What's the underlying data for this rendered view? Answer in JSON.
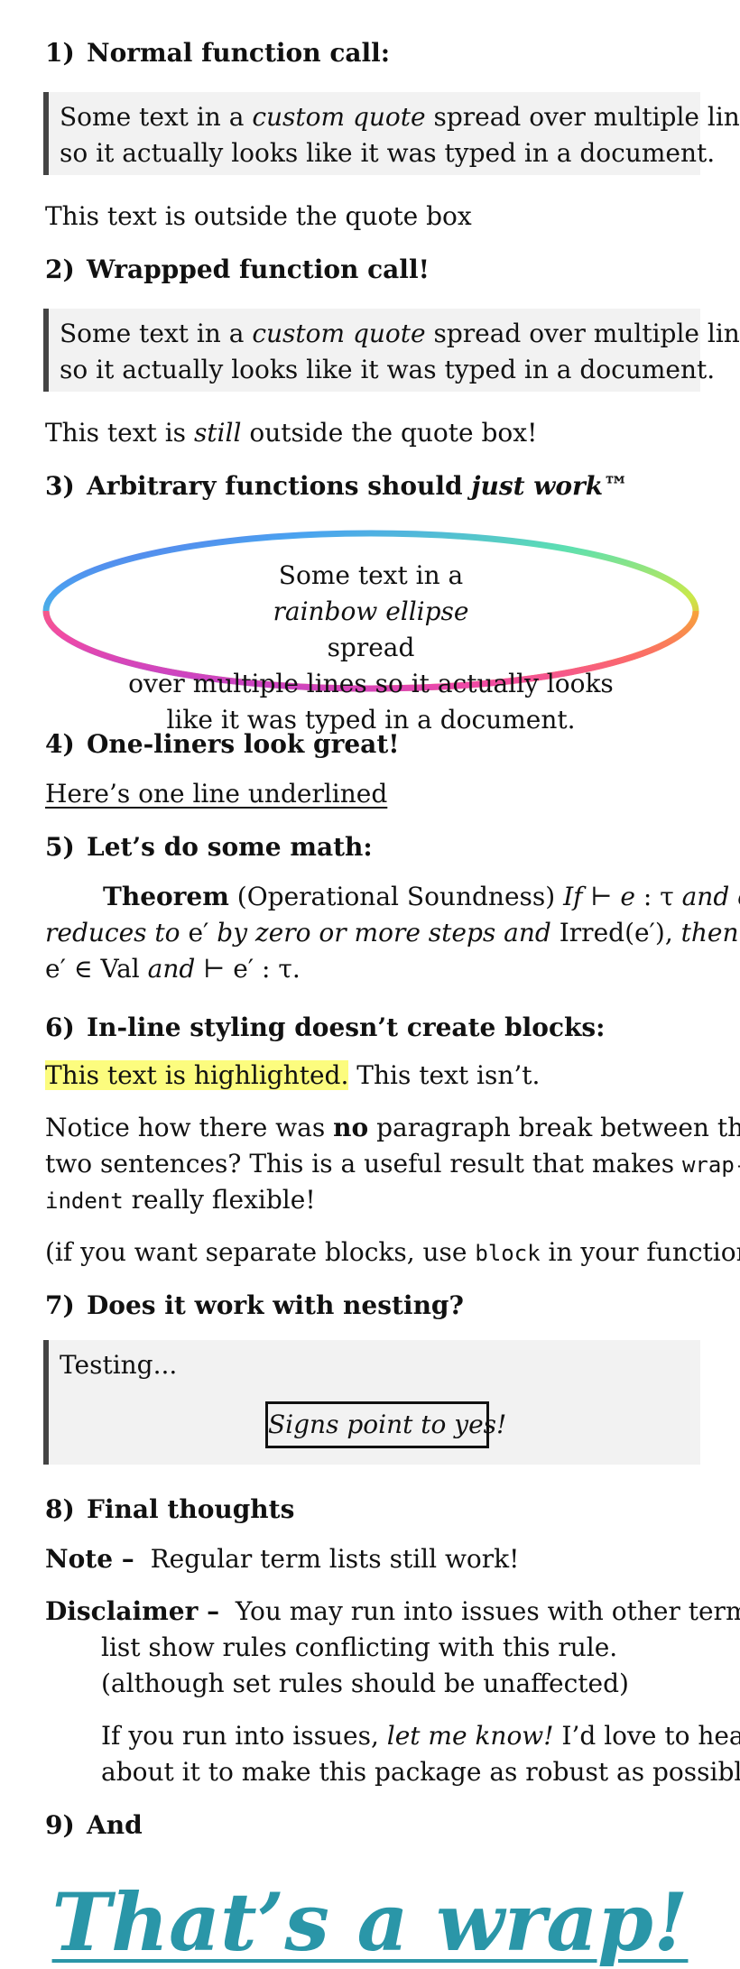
{
  "sections": {
    "s1": {
      "num": "1)",
      "title": "Normal function call:"
    },
    "s2": {
      "num": "2)",
      "title": "Wrappped function call!"
    },
    "s3": {
      "num": "3)",
      "title_a": "Arbitrary functions should ",
      "title_b": "just work™"
    },
    "s4": {
      "num": "4)",
      "title": "One-liners look great!"
    },
    "s5": {
      "num": "5)",
      "title": "Let’s do some math:"
    },
    "s6": {
      "num": "6)",
      "title": "In-line styling doesn’t create blocks:"
    },
    "s7": {
      "num": "7)",
      "title": "Does it work with nesting?"
    },
    "s8": {
      "num": "8)",
      "title": "Final thoughts"
    },
    "s9": {
      "num": "9)",
      "title": "And"
    }
  },
  "quote1": {
    "a": "Some text in a ",
    "b": "custom quote",
    "c": " spread over multiple lines",
    "d": "so it actually looks like it was typed in a document."
  },
  "outside1": "This text is outside the quote box",
  "quote2": {
    "a": "Some text in a ",
    "b": "custom quote",
    "c": " spread over multiple lines",
    "d": "so it actually looks like it was typed in a document."
  },
  "outside2": {
    "a": "This text is ",
    "b": "still",
    "c": " outside the quote box!"
  },
  "ellipse": {
    "l1a": "Some text in a ",
    "l1b": "rainbow ellipse",
    "l1c": " spread",
    "l2": "over multiple lines so it actually looks",
    "l3": "like it was typed in a document."
  },
  "underlined": "Here’s one line underlined",
  "theorem": {
    "name": "Theorem",
    "paren": " (Operational Soundness) ",
    "l1a": "If ⊢ ",
    "l1b": "e",
    "l1c": " : τ ",
    "l1d": "and",
    "l1e": " e",
    "l2a": "reduces to",
    "l2b": " e′ ",
    "l2c": "by zero or more steps and ",
    "l2d": "Irred",
    "l2e": "(e′), ",
    "l2f": "then",
    "l3a": "e′ ∈ Val ",
    "l3b": "and",
    "l3c": " ⊢ e′ : τ."
  },
  "inline": {
    "hl": "This text is highlighted.",
    "rest": " This text isn’t."
  },
  "notice": {
    "a": "Notice how there was ",
    "b": "no",
    "c": " paragraph break between the",
    "d": "two sentences? This is a useful result that makes ",
    "e": "wrap-",
    "f": "indent",
    "g": " really flexible!"
  },
  "separate": {
    "a": "(if you want separate blocks, use ",
    "b": "block",
    "c": " in your function)"
  },
  "nesting": {
    "testing": "Testing...",
    "signs": "Signs point to yes!"
  },
  "terms": {
    "note_term": "Note –",
    "note_desc": "Regular term lists still work!",
    "disc_term": "Disclaimer –",
    "disc_l1": "You may run into issues with other term",
    "disc_l2": "list show rules conflicting with this rule.",
    "disc_l3": "(although set rules should be unaffected)",
    "disc_p2a": "If you run into issues, ",
    "disc_p2b": "let me know!",
    "disc_p2c": " I’d love to hear",
    "disc_p2d": "about it to make this package as robust as possible."
  },
  "final": "That’s a wrap!",
  "colors": {
    "highlight": "#fcfc7e",
    "quote_bg": "#f2f2f2",
    "quote_bar": "#444444",
    "final_text": "#2a96a8"
  }
}
